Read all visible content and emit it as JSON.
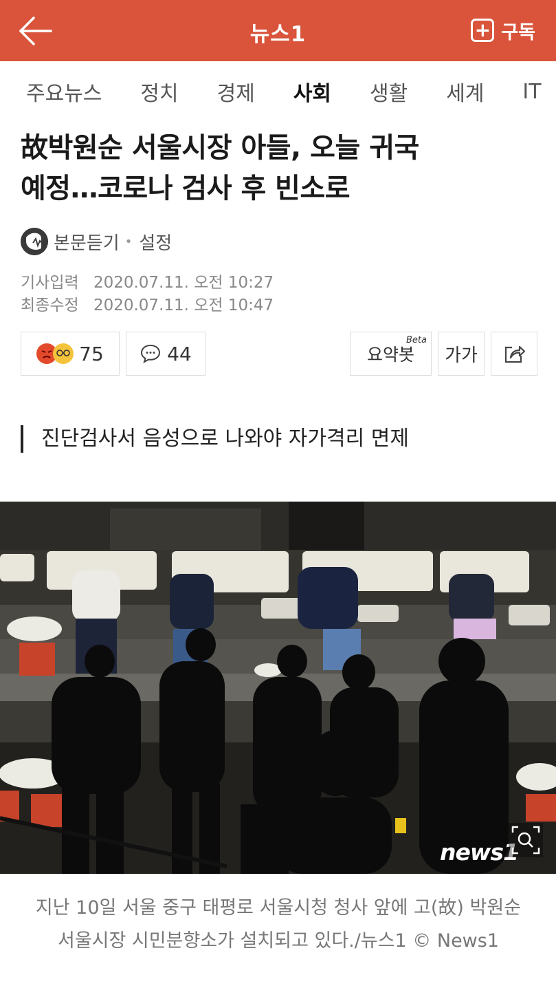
{
  "header": {
    "brand": "뉴스1",
    "subscribe_label": "구독",
    "accent_color": "#d9543a"
  },
  "tabs": [
    {
      "label": "주요뉴스",
      "active": false
    },
    {
      "label": "정치",
      "active": false
    },
    {
      "label": "경제",
      "active": false
    },
    {
      "label": "사회",
      "active": true
    },
    {
      "label": "생활",
      "active": false
    },
    {
      "label": "세계",
      "active": false
    },
    {
      "label": "IT",
      "active": false
    }
  ],
  "article": {
    "title_line1": "故박원순 서울시장 아들, 오늘 귀국",
    "title_line2": "예정…코로나 검사 후 빈소로",
    "listen_label": "본문듣기",
    "settings_label": "설정",
    "published_label": "기사입력",
    "published_value": "2020.07.11. 오전 10:27",
    "updated_label": "최종수정",
    "updated_value": "2020.07.11. 오전 10:47",
    "subheading": "진단검사서 음성으로 나와야 자가격리 면제",
    "photo_watermark": "news1",
    "caption": "지난 10일 서울 중구 태평로 서울시청 청사 앞에 고(故) 박원순 서울시장 시민분향소가 설치되고 있다./뉴스1 © News1"
  },
  "actions": {
    "reaction_count": "75",
    "comment_count": "44",
    "summary_label": "요약봇",
    "summary_badge": "Beta",
    "font_size_label": "가가"
  }
}
